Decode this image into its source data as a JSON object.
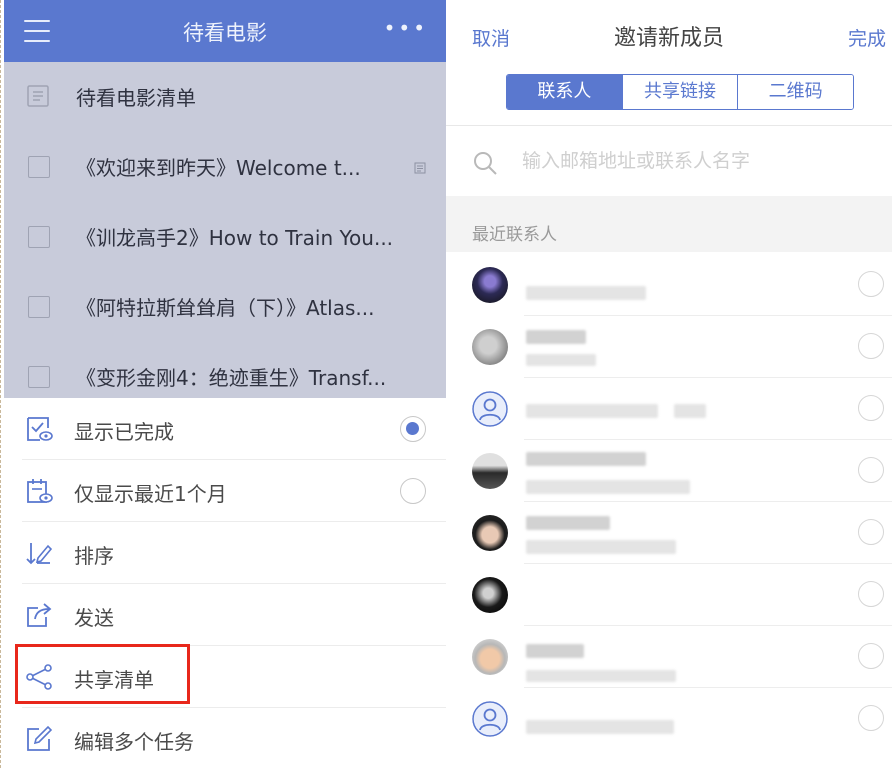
{
  "left": {
    "header": {
      "title": "待看电影"
    },
    "list": {
      "title": "待看电影清单",
      "items": [
        "《欢迎来到昨天》Welcome t...",
        "《训龙高手2》How to Train You...",
        "《阿特拉斯耸耸肩（下）》Atlas...",
        "《变形金刚4：绝迹重生》Transf..."
      ]
    },
    "menu": {
      "show_completed": "显示已完成",
      "recent_month": "仅显示最近1个月",
      "sort": "排序",
      "send": "发送",
      "share_list": "共享清单",
      "edit_multiple": "编辑多个任务"
    },
    "options": {
      "show_completed_selected": true,
      "recent_month_selected": false
    }
  },
  "right": {
    "nav": {
      "cancel": "取消",
      "title": "邀请新成员",
      "done": "完成"
    },
    "tabs": [
      "联系人",
      "共享链接",
      "二维码"
    ],
    "active_tab": 0,
    "search": {
      "placeholder": "输入邮箱地址或联系人名字"
    },
    "recent_label": "最近联系人"
  },
  "colors": {
    "accent": "#5a78cf",
    "highlight": "#e8271b",
    "list_bg": "#c8cbda"
  }
}
